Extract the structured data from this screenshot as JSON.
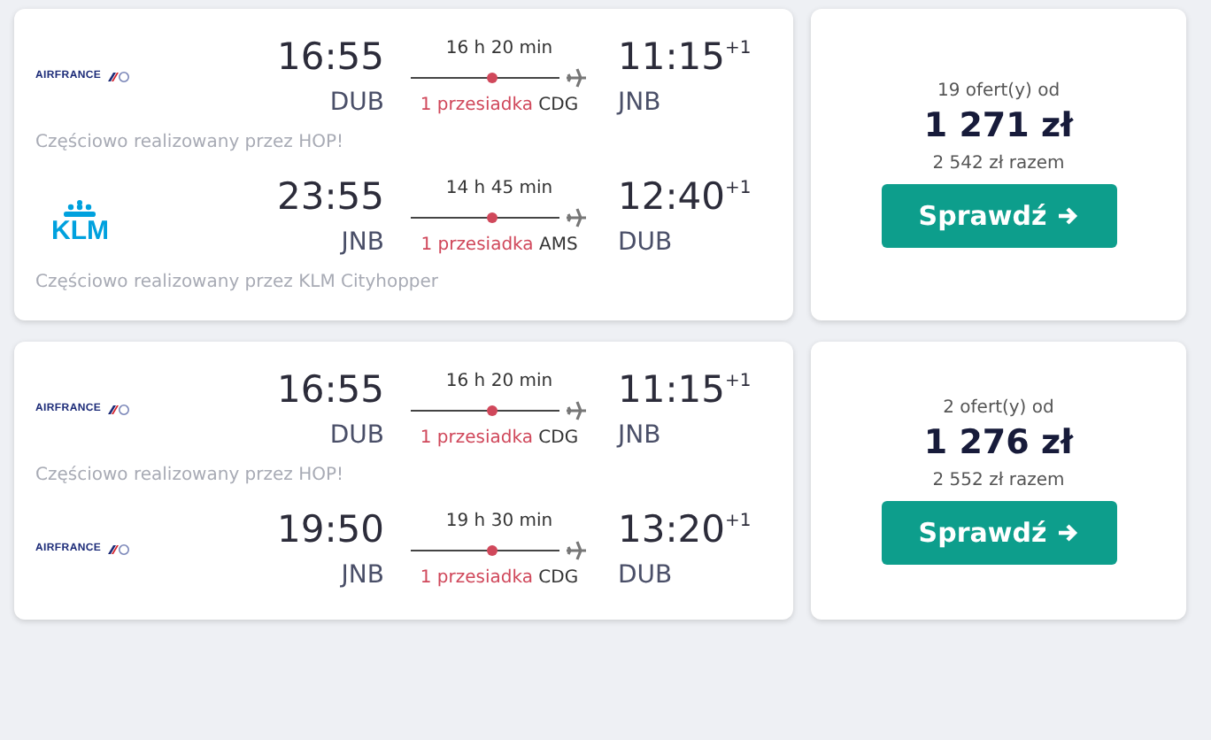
{
  "results": [
    {
      "legs": [
        {
          "airline": {
            "kind": "airfrance",
            "name": "AIRFRANCE"
          },
          "depart_time": "16:55",
          "depart_airport": "DUB",
          "duration": "16 h 20 min",
          "stops": "1 przesiadka",
          "via": "CDG",
          "arrive_time": "11:15",
          "day_offset": "+1",
          "arrive_airport": "JNB",
          "operated_by": "Częściowo realizowany przez HOP!"
        },
        {
          "airline": {
            "kind": "klm",
            "name": "KLM"
          },
          "depart_time": "23:55",
          "depart_airport": "JNB",
          "duration": "14 h 45 min",
          "stops": "1 przesiadka",
          "via": "AMS",
          "arrive_time": "12:40",
          "day_offset": "+1",
          "arrive_airport": "DUB",
          "operated_by": "Częściowo realizowany przez KLM Cityhopper"
        }
      ],
      "offers": "19 ofert(y) od",
      "price": "1 271 zł",
      "total": "2 542 zł razem",
      "button": "Sprawdź"
    },
    {
      "legs": [
        {
          "airline": {
            "kind": "airfrance",
            "name": "AIRFRANCE"
          },
          "depart_time": "16:55",
          "depart_airport": "DUB",
          "duration": "16 h 20 min",
          "stops": "1 przesiadka",
          "via": "CDG",
          "arrive_time": "11:15",
          "day_offset": "+1",
          "arrive_airport": "JNB",
          "operated_by": "Częściowo realizowany przez HOP!"
        },
        {
          "airline": {
            "kind": "airfrance",
            "name": "AIRFRANCE"
          },
          "depart_time": "19:50",
          "depart_airport": "JNB",
          "duration": "19 h 30 min",
          "stops": "1 przesiadka",
          "via": "CDG",
          "arrive_time": "13:20",
          "day_offset": "+1",
          "arrive_airport": "DUB"
        }
      ],
      "offers": "2 ofert(y) od",
      "price": "1 276 zł",
      "total": "2 552 zł razem",
      "button": "Sprawdź"
    }
  ]
}
